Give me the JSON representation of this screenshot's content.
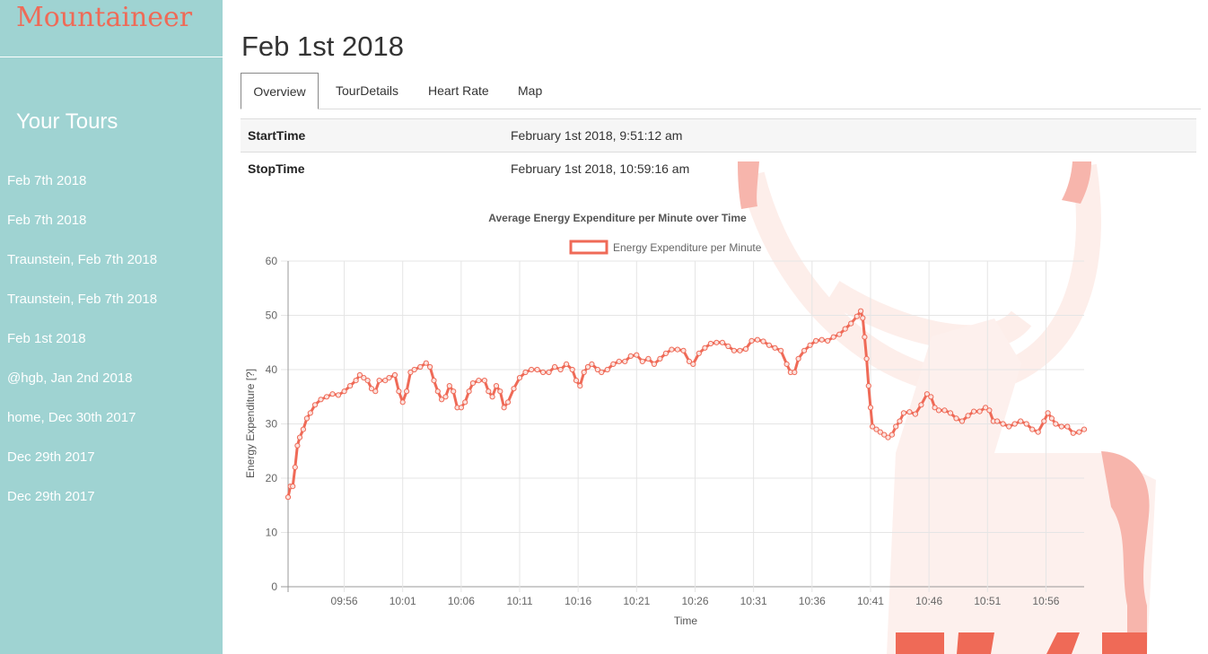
{
  "app": {
    "brand": "Mountaineer"
  },
  "sidebar": {
    "heading": "Your Tours",
    "tours": [
      "Feb 7th 2018",
      "Feb 7th 2018",
      "Traunstein, Feb 7th 2018",
      "Traunstein, Feb 7th 2018",
      "Feb 1st 2018",
      "@hgb, Jan 2nd 2018",
      "home, Dec 30th 2017",
      "Dec 29th 2017",
      "Dec 29th 2017"
    ]
  },
  "page": {
    "title": "Feb 1st 2018"
  },
  "tabs": [
    {
      "label": "Overview",
      "active": true
    },
    {
      "label": "TourDetails",
      "active": false
    },
    {
      "label": "Heart Rate",
      "active": false
    },
    {
      "label": "Map",
      "active": false
    }
  ],
  "details": [
    {
      "key": "StartTime",
      "value": "February 1st 2018, 9:51:12 am"
    },
    {
      "key": "StopTime",
      "value": "February 1st 2018, 10:59:16 am"
    }
  ],
  "colors": {
    "sidebar": "#9fd3d2",
    "accent": "#ef6a57",
    "deer": "#f7b5ac"
  },
  "chart_data": {
    "type": "line",
    "title": "Average Energy Expenditure per Minute over Time",
    "xlabel": "Time",
    "ylabel": "Energy Expenditure [?]",
    "ylim": [
      0,
      60
    ],
    "yticks": [
      0,
      10,
      20,
      30,
      40,
      50,
      60
    ],
    "xticks": [
      "09:56",
      "10:01",
      "10:06",
      "10:11",
      "10:16",
      "10:21",
      "10:26",
      "10:31",
      "10:36",
      "10:41",
      "10:46",
      "10:51",
      "10:56"
    ],
    "xrange": [
      "09:51:12",
      "10:59:16"
    ],
    "grid": true,
    "legend_position": "top",
    "series": [
      {
        "name": "Energy Expenditure per Minute",
        "color": "#ef6a57",
        "points": [
          [
            "09:51:12",
            16.5
          ],
          [
            "09:51:24",
            18.5
          ],
          [
            "09:51:36",
            18.5
          ],
          [
            "09:51:48",
            22
          ],
          [
            "09:52:00",
            26
          ],
          [
            "09:52:12",
            27.5
          ],
          [
            "09:52:30",
            29
          ],
          [
            "09:52:48",
            31
          ],
          [
            "09:53:06",
            32
          ],
          [
            "09:53:30",
            33.5
          ],
          [
            "09:54:00",
            34.5
          ],
          [
            "09:54:30",
            35
          ],
          [
            "09:55:00",
            35.5
          ],
          [
            "09:55:30",
            35.3
          ],
          [
            "09:56:00",
            36
          ],
          [
            "09:56:30",
            37
          ],
          [
            "09:57:00",
            38
          ],
          [
            "09:57:20",
            39
          ],
          [
            "09:57:40",
            38.5
          ],
          [
            "09:58:00",
            38
          ],
          [
            "09:58:20",
            36.5
          ],
          [
            "09:58:40",
            36
          ],
          [
            "09:59:00",
            38
          ],
          [
            "09:59:30",
            38
          ],
          [
            "09:59:50",
            38.5
          ],
          [
            "10:00:20",
            39
          ],
          [
            "10:00:40",
            36
          ],
          [
            "10:01:00",
            34
          ],
          [
            "10:01:20",
            36
          ],
          [
            "10:01:40",
            39.5
          ],
          [
            "10:02:00",
            40
          ],
          [
            "10:02:30",
            40.5
          ],
          [
            "10:03:00",
            41.2
          ],
          [
            "10:03:20",
            40.5
          ],
          [
            "10:03:40",
            38
          ],
          [
            "10:04:00",
            36
          ],
          [
            "10:04:20",
            34.5
          ],
          [
            "10:04:40",
            35
          ],
          [
            "10:05:00",
            37
          ],
          [
            "10:05:20",
            36
          ],
          [
            "10:05:40",
            33
          ],
          [
            "10:06:00",
            33
          ],
          [
            "10:06:20",
            34
          ],
          [
            "10:06:40",
            36
          ],
          [
            "10:07:00",
            37.5
          ],
          [
            "10:07:30",
            38
          ],
          [
            "10:08:00",
            38
          ],
          [
            "10:08:20",
            36
          ],
          [
            "10:08:40",
            35
          ],
          [
            "10:09:00",
            37
          ],
          [
            "10:09:20",
            36
          ],
          [
            "10:09:40",
            33
          ],
          [
            "10:10:00",
            34
          ],
          [
            "10:10:30",
            36.5
          ],
          [
            "10:11:00",
            38.5
          ],
          [
            "10:11:30",
            39.5
          ],
          [
            "10:12:00",
            40
          ],
          [
            "10:12:30",
            40
          ],
          [
            "10:13:00",
            39.5
          ],
          [
            "10:13:30",
            39.5
          ],
          [
            "10:14:00",
            40.5
          ],
          [
            "10:14:30",
            40
          ],
          [
            "10:15:00",
            41
          ],
          [
            "10:15:30",
            40
          ],
          [
            "10:15:50",
            38
          ],
          [
            "10:16:10",
            37
          ],
          [
            "10:16:30",
            39.5
          ],
          [
            "10:16:50",
            40.5
          ],
          [
            "10:17:10",
            41
          ],
          [
            "10:17:40",
            40
          ],
          [
            "10:18:00",
            39.5
          ],
          [
            "10:18:30",
            40
          ],
          [
            "10:19:00",
            41
          ],
          [
            "10:19:30",
            41.5
          ],
          [
            "10:20:00",
            41.5
          ],
          [
            "10:20:30",
            42.5
          ],
          [
            "10:21:00",
            42.7
          ],
          [
            "10:21:30",
            41.5
          ],
          [
            "10:22:00",
            42
          ],
          [
            "10:22:30",
            41
          ],
          [
            "10:23:00",
            42
          ],
          [
            "10:23:30",
            43
          ],
          [
            "10:24:00",
            43.7
          ],
          [
            "10:24:30",
            43.7
          ],
          [
            "10:25:00",
            43.5
          ],
          [
            "10:25:30",
            41.5
          ],
          [
            "10:25:50",
            41
          ],
          [
            "10:26:20",
            43
          ],
          [
            "10:26:50",
            44
          ],
          [
            "10:27:20",
            44.8
          ],
          [
            "10:27:50",
            45
          ],
          [
            "10:28:20",
            45
          ],
          [
            "10:28:50",
            44.3
          ],
          [
            "10:29:20",
            43.5
          ],
          [
            "10:29:50",
            43.5
          ],
          [
            "10:30:20",
            43.8
          ],
          [
            "10:30:50",
            45.3
          ],
          [
            "10:31:20",
            45.5
          ],
          [
            "10:31:50",
            45.2
          ],
          [
            "10:32:20",
            44.5
          ],
          [
            "10:32:50",
            44
          ],
          [
            "10:33:20",
            43.5
          ],
          [
            "10:33:50",
            41
          ],
          [
            "10:34:10",
            39.5
          ],
          [
            "10:34:30",
            39.5
          ],
          [
            "10:34:50",
            42
          ],
          [
            "10:35:20",
            43.5
          ],
          [
            "10:35:50",
            44.5
          ],
          [
            "10:36:20",
            45.3
          ],
          [
            "10:36:50",
            45.5
          ],
          [
            "10:37:20",
            45.3
          ],
          [
            "10:37:50",
            46
          ],
          [
            "10:38:20",
            46.5
          ],
          [
            "10:38:50",
            47.5
          ],
          [
            "10:39:20",
            48.5
          ],
          [
            "10:39:50",
            49.8
          ],
          [
            "10:40:10",
            50.8
          ],
          [
            "10:40:20",
            49.5
          ],
          [
            "10:40:30",
            46
          ],
          [
            "10:40:40",
            42
          ],
          [
            "10:40:50",
            37
          ],
          [
            "10:41:00",
            33
          ],
          [
            "10:41:10",
            29.5
          ],
          [
            "10:41:30",
            29
          ],
          [
            "10:41:50",
            28.5
          ],
          [
            "10:42:10",
            28
          ],
          [
            "10:42:30",
            27.5
          ],
          [
            "10:42:50",
            28
          ],
          [
            "10:43:10",
            29.5
          ],
          [
            "10:43:30",
            30.5
          ],
          [
            "10:43:50",
            32
          ],
          [
            "10:44:20",
            32.2
          ],
          [
            "10:44:50",
            31.8
          ],
          [
            "10:45:20",
            33.5
          ],
          [
            "10:45:50",
            35.5
          ],
          [
            "10:46:10",
            35
          ],
          [
            "10:46:30",
            33
          ],
          [
            "10:46:50",
            32.5
          ],
          [
            "10:47:20",
            32.5
          ],
          [
            "10:47:50",
            32
          ],
          [
            "10:48:20",
            31
          ],
          [
            "10:48:50",
            30.5
          ],
          [
            "10:49:20",
            31.5
          ],
          [
            "10:49:50",
            32.3
          ],
          [
            "10:50:20",
            32.3
          ],
          [
            "10:50:50",
            33
          ],
          [
            "10:51:10",
            32.5
          ],
          [
            "10:51:30",
            30.5
          ],
          [
            "10:51:50",
            30.5
          ],
          [
            "10:52:20",
            30
          ],
          [
            "10:52:50",
            29.5
          ],
          [
            "10:53:20",
            30
          ],
          [
            "10:53:50",
            30.5
          ],
          [
            "10:54:20",
            30
          ],
          [
            "10:54:50",
            29
          ],
          [
            "10:55:20",
            28.5
          ],
          [
            "10:55:50",
            30.5
          ],
          [
            "10:56:10",
            32
          ],
          [
            "10:56:30",
            31
          ],
          [
            "10:56:50",
            30
          ],
          [
            "10:57:20",
            29.5
          ],
          [
            "10:57:50",
            29.5
          ],
          [
            "10:58:20",
            28.3
          ],
          [
            "10:58:50",
            28.5
          ],
          [
            "10:59:16",
            29
          ]
        ]
      }
    ]
  }
}
